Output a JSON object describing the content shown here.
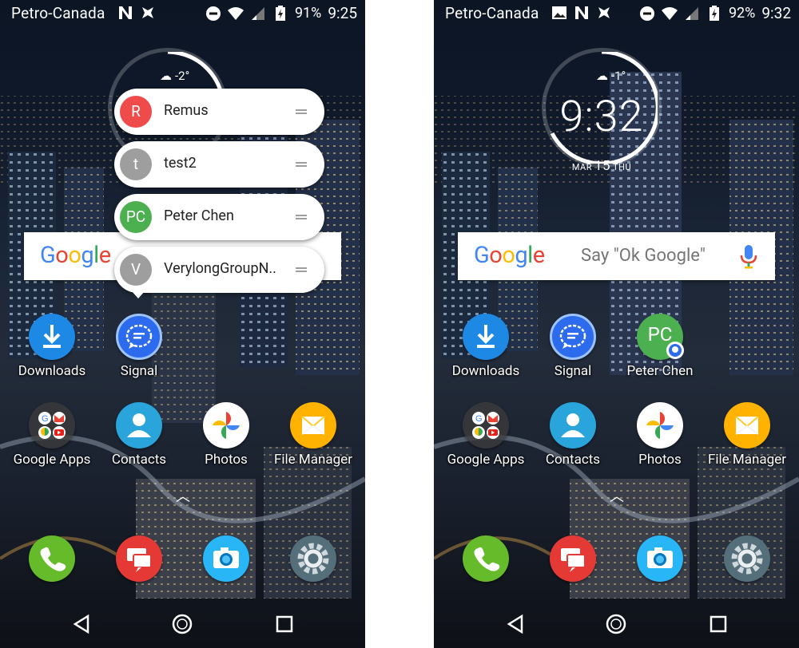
{
  "left": {
    "status": {
      "carrier": "Petro-Canada",
      "battery": "91%",
      "time": "9:25"
    },
    "clock": {
      "temp": "-2°"
    },
    "shortcuts": [
      {
        "initial": "R",
        "name": "Remus",
        "color": "#EF4B4B"
      },
      {
        "initial": "t",
        "name": "test2",
        "color": "#9E9E9E"
      },
      {
        "initial": "PC",
        "name": "Peter Chen",
        "color": "#4CAF50"
      },
      {
        "initial": "V",
        "name": "VerylongGroupN..",
        "color": "#9E9E9E"
      }
    ],
    "apps_row1": [
      {
        "label": "Downloads",
        "icon": "download-icon"
      },
      {
        "label": "Signal",
        "icon": "signal-chat-icon"
      }
    ],
    "apps_row2": [
      {
        "label": "Google Apps",
        "icon": "google-apps-folder-icon"
      },
      {
        "label": "Contacts",
        "icon": "contacts-icon"
      },
      {
        "label": "Photos",
        "icon": "photos-pinwheel-icon"
      },
      {
        "label": "File Manager",
        "icon": "file-manager-icon"
      }
    ]
  },
  "right": {
    "status": {
      "carrier": "Petro-Canada",
      "battery": "92%",
      "time": "9:32"
    },
    "clock": {
      "temp": "-1°",
      "time": "9:32",
      "month": "MAR",
      "day": "15",
      "weekday": "THU"
    },
    "google": {
      "placeholder": "Say \"Ok Google\""
    },
    "apps_row1": [
      {
        "label": "Downloads",
        "icon": "download-icon"
      },
      {
        "label": "Signal",
        "icon": "signal-chat-icon"
      },
      {
        "label": "Peter Chen",
        "icon": "contact-shortcut-icon",
        "initials": "PC"
      }
    ],
    "apps_row2": [
      {
        "label": "Google Apps",
        "icon": "google-apps-folder-icon"
      },
      {
        "label": "Contacts",
        "icon": "contacts-icon"
      },
      {
        "label": "Photos",
        "icon": "photos-pinwheel-icon"
      },
      {
        "label": "File Manager",
        "icon": "file-manager-icon"
      }
    ]
  },
  "google_logo": [
    "G",
    "o",
    "o",
    "g",
    "l",
    "e"
  ],
  "dock": [
    "phone-icon",
    "messages-icon",
    "camera-icon",
    "settings-icon"
  ],
  "colors": {
    "signal_blue": "#2C6BED",
    "downloads_blue": "#1E88E5",
    "phone_green": "#66BB2A",
    "messages_red": "#E53935",
    "camera_blue": "#29B6F6",
    "settings_gray": "#546E7A",
    "file_orange": "#FFB300"
  }
}
